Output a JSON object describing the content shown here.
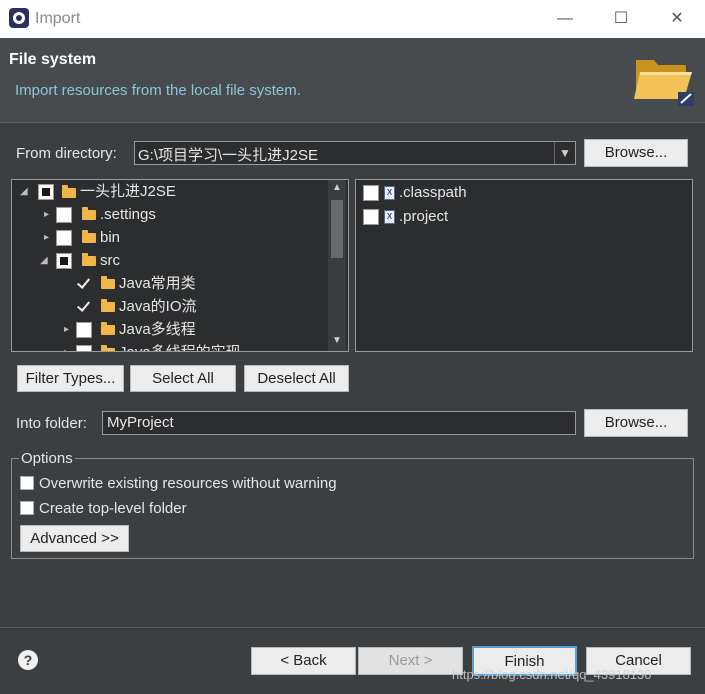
{
  "window": {
    "title": "Import",
    "controls": [
      "—",
      "☐",
      "✕"
    ]
  },
  "banner": {
    "title": "File system",
    "description": "Import resources from the local file system."
  },
  "from_directory": {
    "label": "From directory:",
    "value": "G:\\项目学习\\一头扎进J2SE",
    "browse": "Browse..."
  },
  "tree": [
    {
      "label": "一头扎进J2SE",
      "state": "tri",
      "expanded": true
    },
    {
      "label": ".settings",
      "state": "none",
      "expanded": false
    },
    {
      "label": "bin",
      "state": "none",
      "expanded": false
    },
    {
      "label": "src",
      "state": "tri",
      "expanded": true
    },
    {
      "label": "Java常用类",
      "state": "checked"
    },
    {
      "label": "Java的IO流",
      "state": "checked"
    },
    {
      "label": "Java多线程",
      "state": "none",
      "expanded": false
    },
    {
      "label": "Java多线程的实现",
      "state": "none",
      "expanded": false
    }
  ],
  "files": [
    {
      "label": ".classpath"
    },
    {
      "label": ".project"
    }
  ],
  "selection_buttons": {
    "filter": "Filter Types...",
    "select_all": "Select All",
    "deselect_all": "Deselect All"
  },
  "into_folder": {
    "label": "Into folder:",
    "value": "MyProject",
    "browse": "Browse..."
  },
  "options": {
    "legend": "Options",
    "overwrite": "Overwrite existing resources without warning",
    "create_top": "Create top-level folder",
    "advanced": "Advanced >>"
  },
  "footer": {
    "back": "< Back",
    "next": "Next >",
    "finish": "Finish",
    "cancel": "Cancel"
  },
  "watermark": "https://blog.csdn.net/qq_43918130"
}
